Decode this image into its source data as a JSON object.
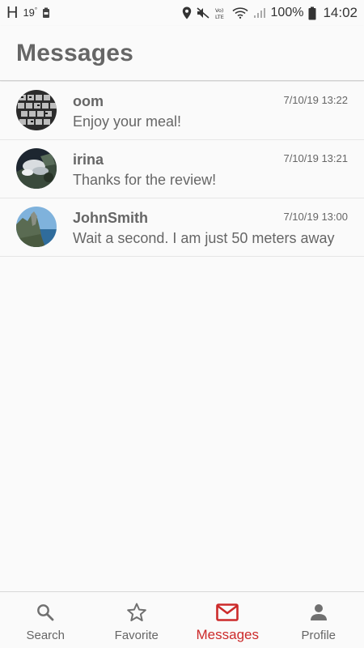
{
  "status_bar": {
    "network_letter": "H",
    "temperature": "19",
    "degree": "°",
    "battery_percent": "100%",
    "time": "14:02"
  },
  "header": {
    "title": "Messages"
  },
  "messages": [
    {
      "sender": "oom",
      "time": "7/10/19 13:22",
      "preview": "Enjoy your meal!"
    },
    {
      "sender": "irina",
      "time": "7/10/19 13:21",
      "preview": "Thanks for the review!"
    },
    {
      "sender": "JohnSmith",
      "time": "7/10/19 13:00",
      "preview": "Wait a second. I am just 50 meters away"
    }
  ],
  "bottom_nav": {
    "items": [
      {
        "label": "Search",
        "icon": "search-icon"
      },
      {
        "label": "Favorite",
        "icon": "star-icon"
      },
      {
        "label": "Messages",
        "icon": "mail-icon",
        "active": true
      },
      {
        "label": "Profile",
        "icon": "person-icon"
      }
    ]
  },
  "colors": {
    "accent": "#cc2a2a",
    "text": "#666666",
    "background": "#fafafa"
  }
}
